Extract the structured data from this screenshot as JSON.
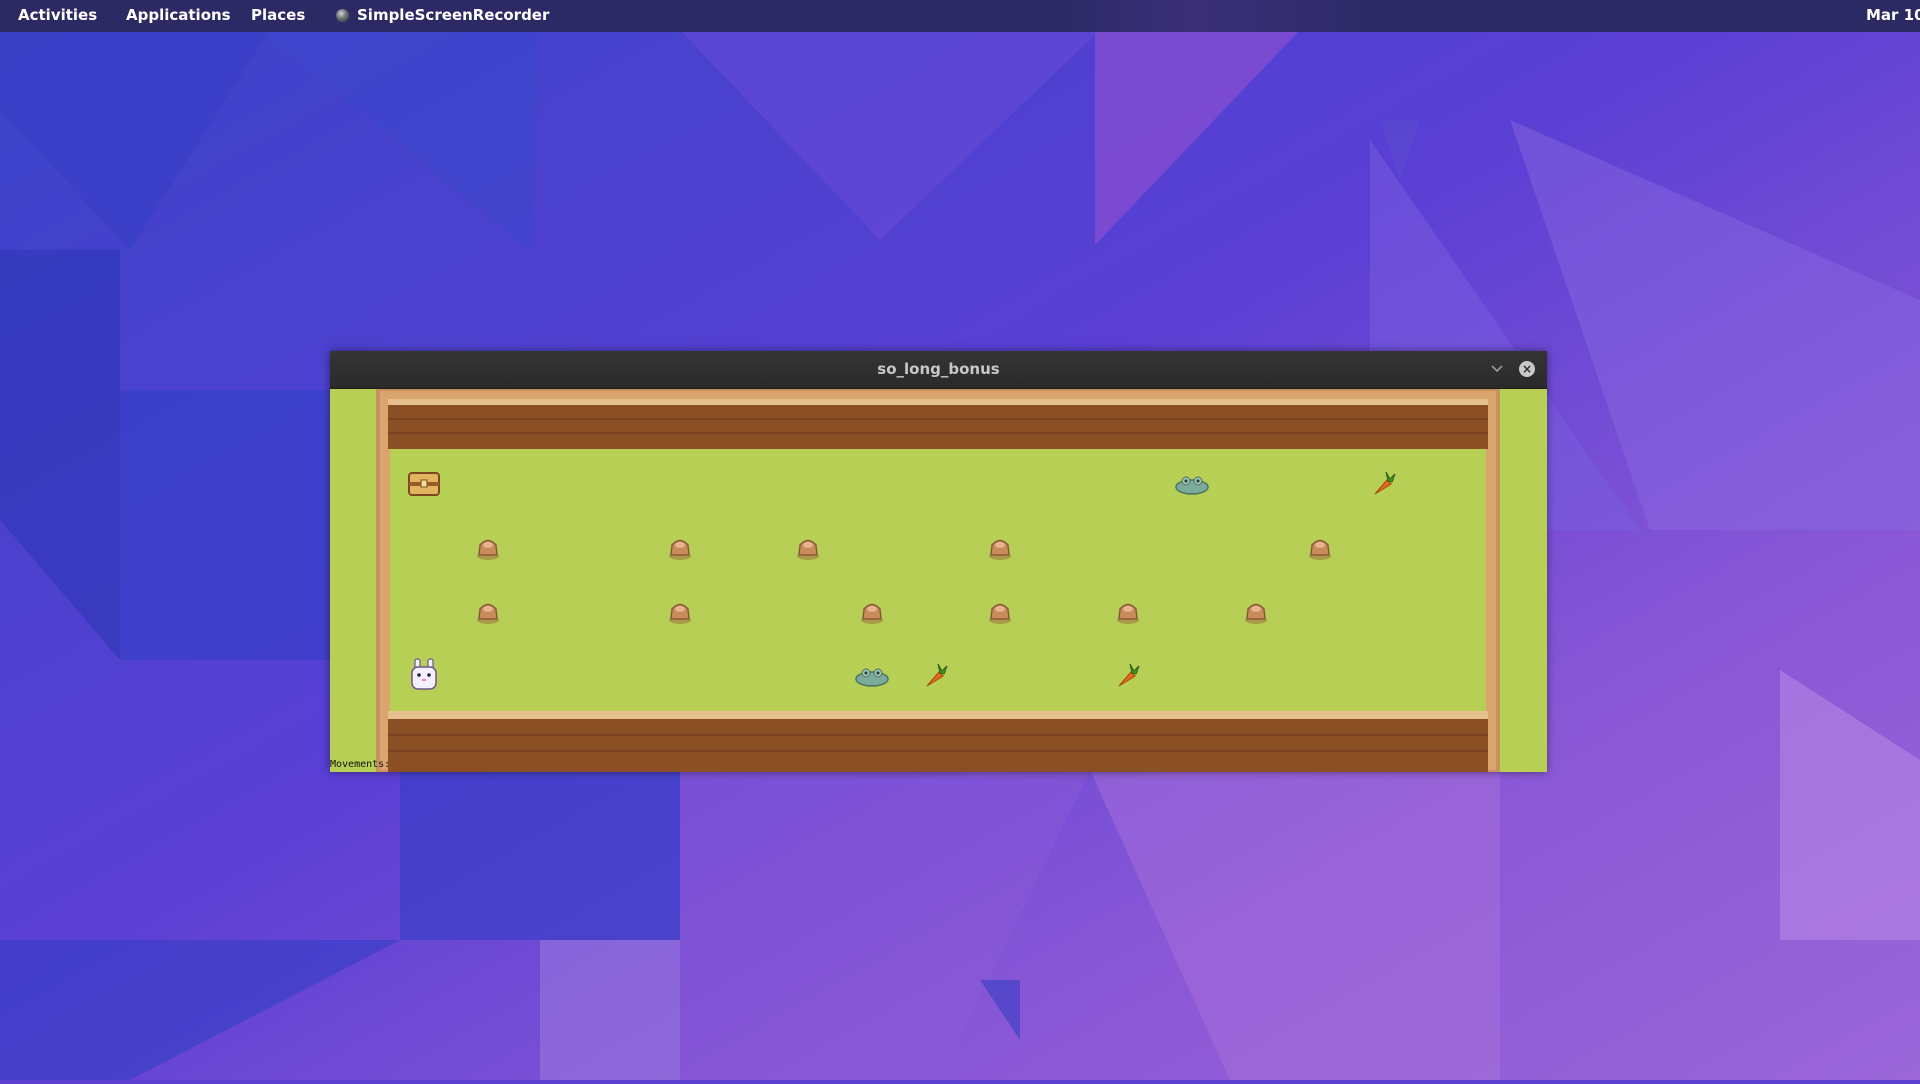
{
  "topbar": {
    "activities": "Activities",
    "applications": "Applications",
    "places": "Places",
    "app_name": "SimpleScreenRecorder",
    "clock": "Mar 10"
  },
  "window": {
    "title": "so_long_bonus",
    "status_text": "Movements:"
  },
  "game": {
    "columns": 17,
    "rows": 4,
    "tiles": [
      "E...........G..C.",
      ".O..O.O..O....O..",
      ".O..O..O.O.O.O...",
      "P......GC..C....."
    ],
    "legend": {
      "P": "player-bunny",
      "E": "exit-chest",
      "C": "carrot-collectible",
      "O": "tree-stump-wall",
      "G": "enemy-slime"
    }
  },
  "colors": {
    "grass": "#b7cf55",
    "wood_dark": "#8a4f25",
    "wood_light": "#d9a46e",
    "carrot": "#e66a1f",
    "stump": "#c98a5e",
    "enemy": "#7dab9b"
  }
}
